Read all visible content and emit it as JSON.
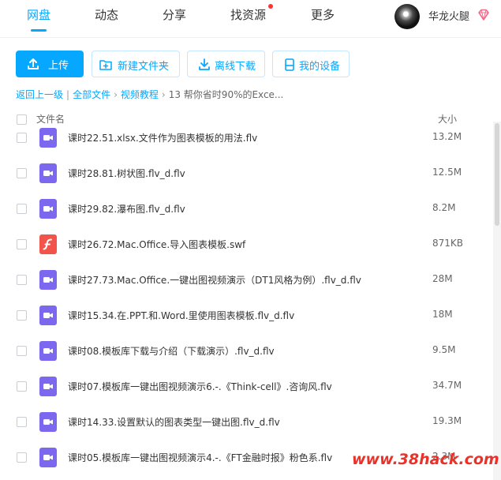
{
  "nav": {
    "tabs": [
      {
        "label": "网盘"
      },
      {
        "label": "动态"
      },
      {
        "label": "分享"
      },
      {
        "label": "找资源"
      },
      {
        "label": "更多"
      }
    ],
    "active_tab": "网盘",
    "user": {
      "name": "华龙火腿"
    }
  },
  "toolbar": {
    "upload": "上传",
    "new_folder": "新建文件夹",
    "offline_download": "离线下载",
    "my_devices": "我的设备"
  },
  "breadcrumb": {
    "back": "返回上一级",
    "items": [
      "全部文件",
      "视频教程",
      "13 帮你省时90%的Exce..."
    ]
  },
  "table": {
    "headers": {
      "name": "文件名",
      "size": "大小"
    },
    "rows": [
      {
        "name": "课时22.51.xlsx.文件作为图表模板的用法.flv",
        "size": "13.2M",
        "type": "video"
      },
      {
        "name": "课时28.81.树状图.flv_d.flv",
        "size": "12.5M",
        "type": "video"
      },
      {
        "name": "课时29.82.瀑布图.flv_d.flv",
        "size": "8.2M",
        "type": "video"
      },
      {
        "name": "课时26.72.Mac.Office.导入图表模板.swf",
        "size": "871KB",
        "type": "flash"
      },
      {
        "name": "课时27.73.Mac.Office.一键出图视频演示（DT1风格为例）.flv_d.flv",
        "size": "28M",
        "type": "video"
      },
      {
        "name": "课时15.34.在.PPT.和.Word.里使用图表模板.flv_d.flv",
        "size": "18M",
        "type": "video"
      },
      {
        "name": "课时08.模板库下载与介绍（下载演示）.flv_d.flv",
        "size": "9.5M",
        "type": "video"
      },
      {
        "name": "课时07.模板库一键出图视频演示6.-.《Think-cell》.咨询风.flv",
        "size": "34.7M",
        "type": "video"
      },
      {
        "name": "课时14.33.设置默认的图表类型一键出图.flv_d.flv",
        "size": "19.3M",
        "type": "video"
      },
      {
        "name": "课时05.模板库一键出图视频演示4.-.《FT金融时报》粉色系.flv",
        "size": "2.3M",
        "type": "video"
      }
    ]
  },
  "watermark": "www.38hack.com",
  "colors": {
    "accent": "#06a7ff",
    "video_icon": "#7b68ee",
    "flash_icon": "#f2534b",
    "watermark": "#e8322a"
  }
}
